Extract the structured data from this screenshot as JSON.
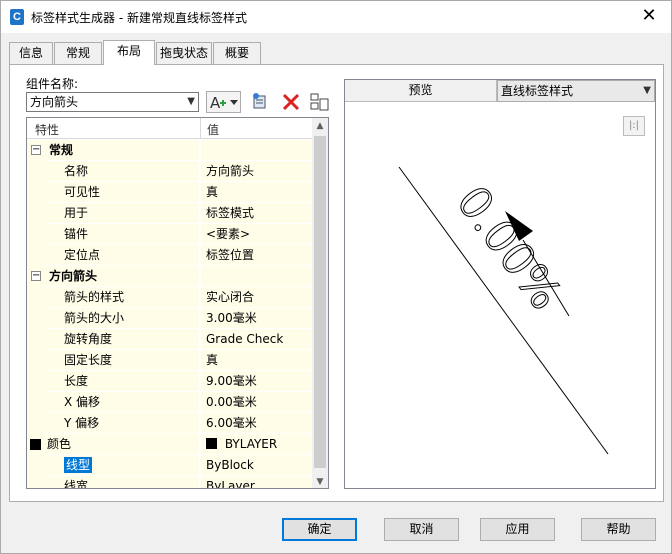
{
  "window": {
    "title": "标签样式生成器 - 新建常规直线标签样式",
    "close_glyph": "✕",
    "app_icon_letter": "C"
  },
  "tabs": [
    {
      "label": "信息",
      "active": false
    },
    {
      "label": "常规",
      "active": false
    },
    {
      "label": "布局",
      "active": true
    },
    {
      "label": "拖曳状态",
      "active": false
    },
    {
      "label": "概要",
      "active": false
    }
  ],
  "component": {
    "label": "组件名称:",
    "value": "方向箭头"
  },
  "toolbar": {
    "icons": [
      "add-text-component-icon",
      "copy-component-icon",
      "delete-component-icon",
      "component-order-icon"
    ]
  },
  "grid": {
    "header": {
      "property": "特性",
      "value": "值"
    },
    "rows": [
      {
        "type": "category",
        "name": "常规",
        "toggle": "⊟"
      },
      {
        "type": "prop",
        "name": "名称",
        "value": "方向箭头"
      },
      {
        "type": "prop",
        "name": "可见性",
        "value": "真"
      },
      {
        "type": "prop",
        "name": "用于",
        "value": "标签模式"
      },
      {
        "type": "prop",
        "name": "锚件",
        "value": "<要素>"
      },
      {
        "type": "prop",
        "name": "定位点",
        "value": "标签位置"
      },
      {
        "type": "category",
        "name": "方向箭头",
        "toggle": "⊟"
      },
      {
        "type": "prop",
        "name": "箭头的样式",
        "value": "实心闭合"
      },
      {
        "type": "prop",
        "name": "箭头的大小",
        "value": "3.00毫米"
      },
      {
        "type": "prop",
        "name": "旋转角度",
        "value": "Grade Check"
      },
      {
        "type": "prop",
        "name": "固定长度",
        "value": "真"
      },
      {
        "type": "prop",
        "name": "长度",
        "value": "9.00毫米"
      },
      {
        "type": "prop",
        "name": "X 偏移",
        "value": "0.00毫米"
      },
      {
        "type": "prop",
        "name": "Y 偏移",
        "value": "6.00毫米"
      },
      {
        "type": "prop",
        "name": "颜色",
        "value": "BYLAYER"
      },
      {
        "type": "prop",
        "name": "线型",
        "value": "ByBlock"
      },
      {
        "type": "prop",
        "name": "线宽",
        "value": "ByLayer"
      }
    ]
  },
  "preview": {
    "label": "预览",
    "style_select": "直线标签样式",
    "sample_text": "0.00%"
  },
  "buttons": {
    "ok": "确定",
    "cancel": "取消",
    "apply": "应用",
    "help": "帮助"
  },
  "colors": {
    "selection": "#0078d7",
    "row_bg": "#fffce8"
  }
}
